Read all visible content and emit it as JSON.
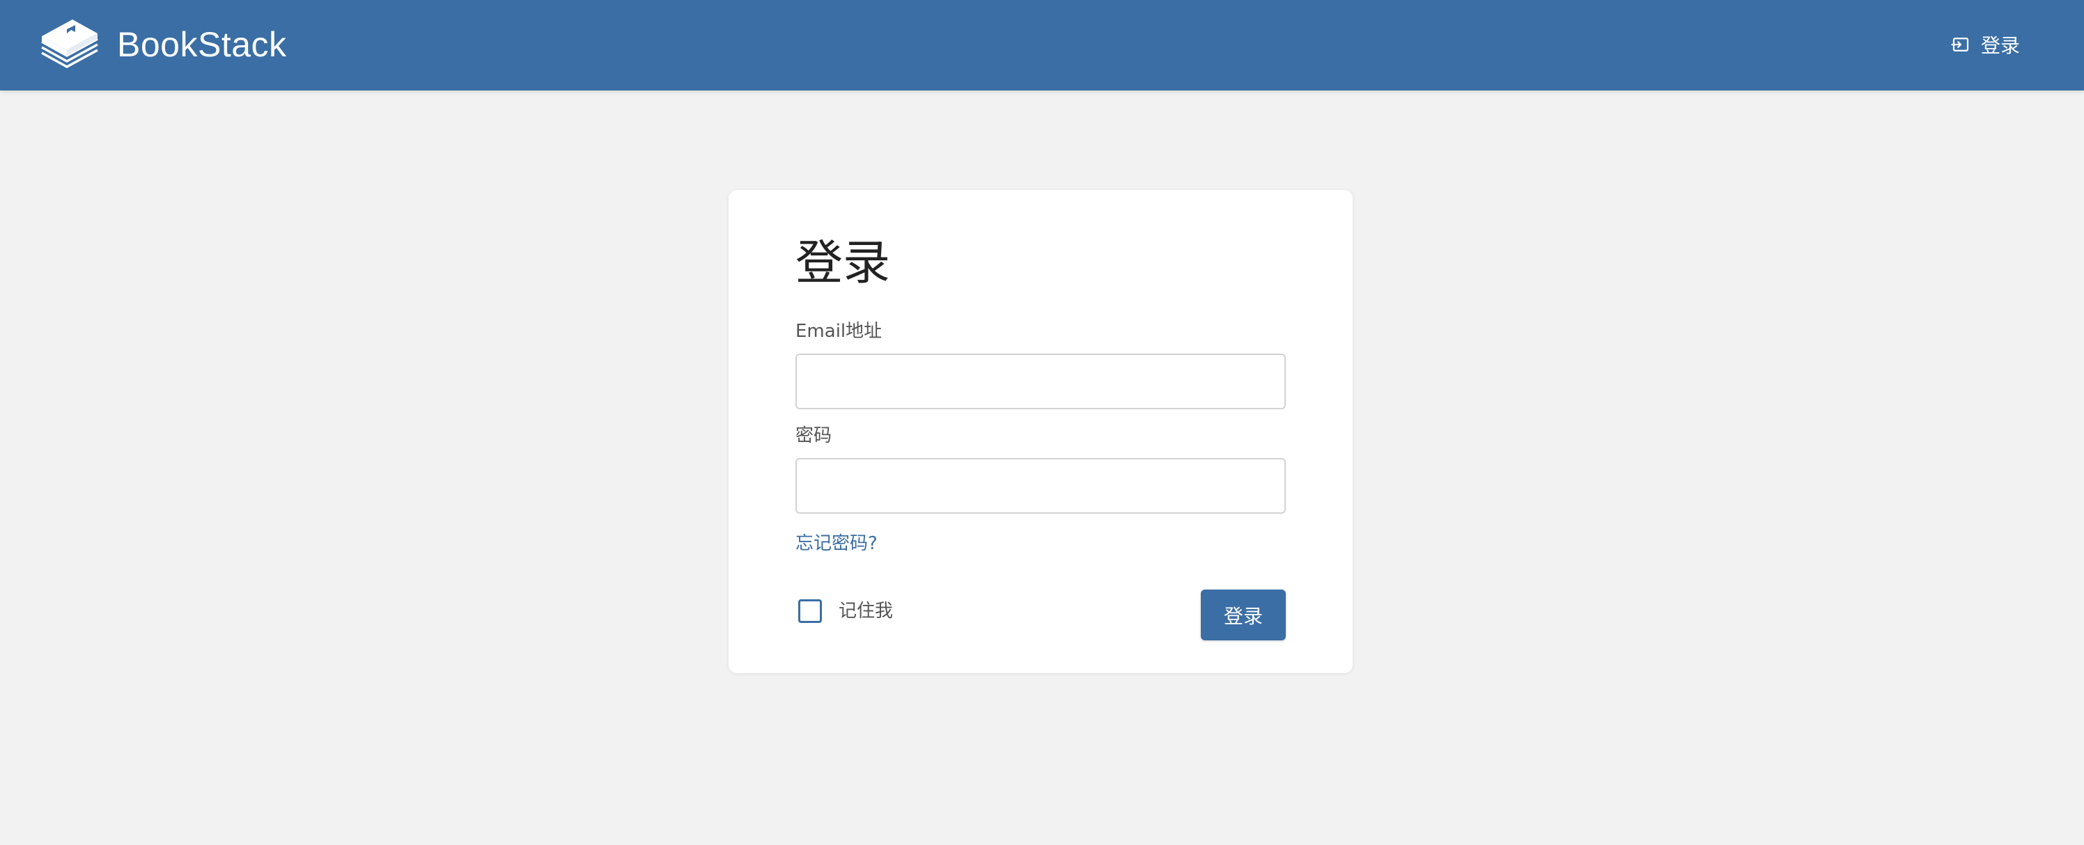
{
  "header": {
    "brand": "BookStack",
    "login_link": "登录",
    "logo_icon": "bookstack-logo-icon",
    "login_icon": "login-icon"
  },
  "login_card": {
    "title": "登录",
    "email_label": "Email地址",
    "email_value": "",
    "password_label": "密码",
    "password_value": "",
    "forgot_password": "忘记密码?",
    "remember_me": "记住我",
    "remember_checked": false,
    "submit": "登录"
  },
  "colors": {
    "primary": "#3a6ea5",
    "background": "#f2f2f2",
    "card": "#ffffff"
  }
}
